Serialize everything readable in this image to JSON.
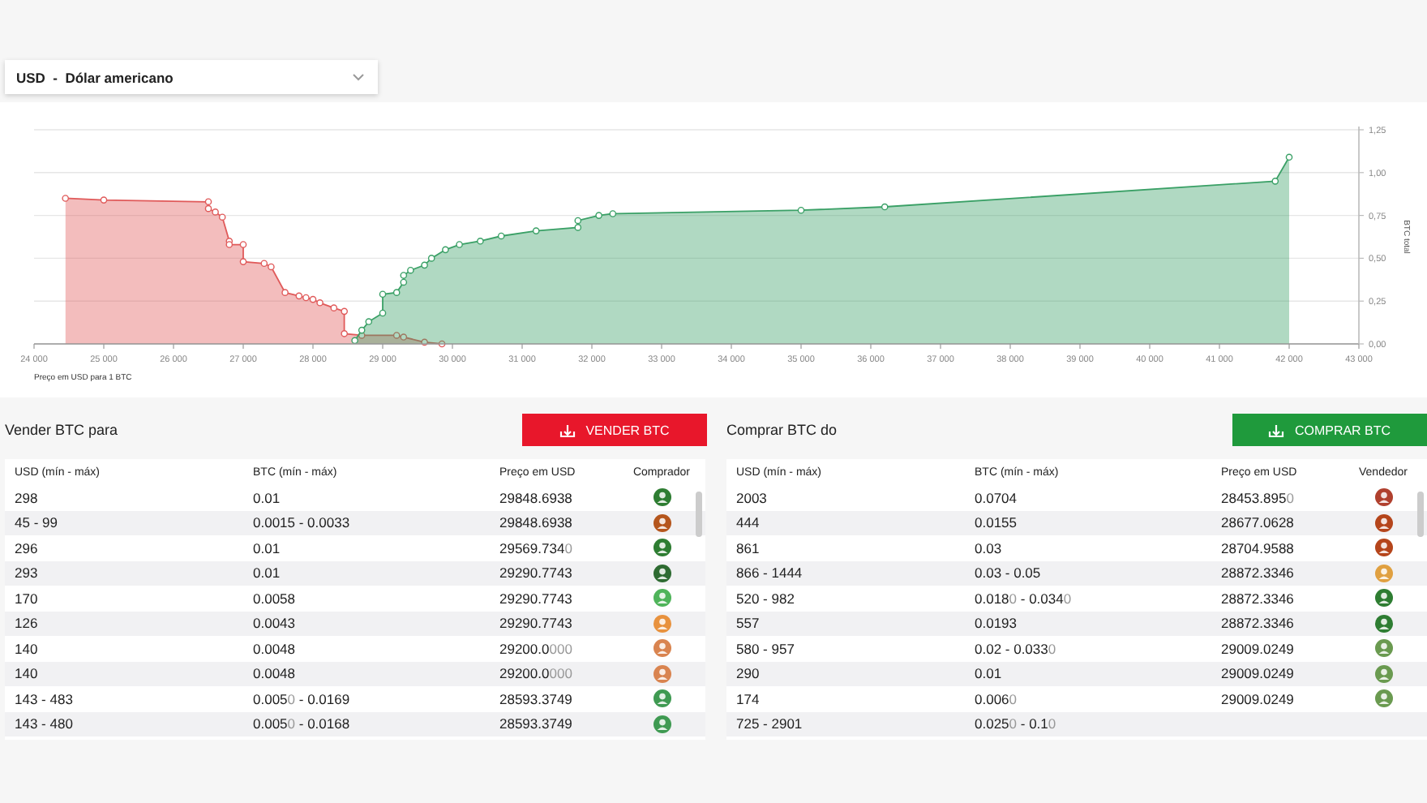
{
  "currency_select": {
    "value": "USD  -  Dólar americano"
  },
  "depth_chart": {
    "chart_data": {
      "type": "area",
      "xlabel": "Preço em USD para 1 BTC",
      "ylabel": "BTC total",
      "xlim": [
        24000,
        43000
      ],
      "ylim": [
        0,
        1.25
      ],
      "grid": true,
      "xticks": [
        {
          "value": 24000,
          "label": "24 000"
        },
        {
          "value": 25000,
          "label": "25 000"
        },
        {
          "value": 26000,
          "label": "26 000"
        },
        {
          "value": 27000,
          "label": "27 000"
        },
        {
          "value": 28000,
          "label": "28 000"
        },
        {
          "value": 29000,
          "label": "29 000"
        },
        {
          "value": 30000,
          "label": "30 000"
        },
        {
          "value": 31000,
          "label": "31 000"
        },
        {
          "value": 32000,
          "label": "32 000"
        },
        {
          "value": 33000,
          "label": "33 000"
        },
        {
          "value": 34000,
          "label": "34 000"
        },
        {
          "value": 35000,
          "label": "35 000"
        },
        {
          "value": 36000,
          "label": "36 000"
        },
        {
          "value": 37000,
          "label": "37 000"
        },
        {
          "value": 38000,
          "label": "38 000"
        },
        {
          "value": 39000,
          "label": "39 000"
        },
        {
          "value": 40000,
          "label": "40 000"
        },
        {
          "value": 41000,
          "label": "41 000"
        },
        {
          "value": 42000,
          "label": "42 000"
        },
        {
          "value": 43000,
          "label": "43 000"
        }
      ],
      "yticks": [
        {
          "value": 0,
          "label": "0,00"
        },
        {
          "value": 0.25,
          "label": "0,25"
        },
        {
          "value": 0.5,
          "label": "0,50"
        },
        {
          "value": 0.75,
          "label": "0,75"
        },
        {
          "value": 1,
          "label": "1,00"
        },
        {
          "value": 1.25,
          "label": "1,25"
        }
      ],
      "series": [
        {
          "color": "#e05a5a",
          "x": [
            24450,
            25000,
            26500,
            26500,
            26600,
            26700,
            26800,
            26800,
            27000,
            27000,
            27300,
            27400,
            27600,
            27800,
            27900,
            28000,
            28100,
            28300,
            28450,
            28450,
            28700,
            29200,
            29300,
            29600,
            29850
          ],
          "values": [
            0.85,
            0.84,
            0.83,
            0.79,
            0.77,
            0.74,
            0.6,
            0.58,
            0.58,
            0.48,
            0.47,
            0.45,
            0.3,
            0.28,
            0.27,
            0.26,
            0.24,
            0.21,
            0.19,
            0.06,
            0.05,
            0.05,
            0.04,
            0.01,
            0.0
          ]
        },
        {
          "color": "#3aa066",
          "x": [
            28600,
            28700,
            28800,
            29000,
            29000,
            29200,
            29300,
            29300,
            29400,
            29600,
            29700,
            29900,
            30100,
            30400,
            30700,
            31200,
            31800,
            31800,
            32100,
            32300,
            35000,
            36200,
            41800,
            42000
          ],
          "values": [
            0.02,
            0.08,
            0.13,
            0.18,
            0.29,
            0.3,
            0.36,
            0.4,
            0.43,
            0.46,
            0.5,
            0.55,
            0.58,
            0.6,
            0.63,
            0.66,
            0.68,
            0.72,
            0.75,
            0.76,
            0.78,
            0.8,
            0.95,
            1.09
          ]
        }
      ]
    }
  },
  "panels": [
    {
      "title": "Vender BTC para",
      "button": {
        "label": "VENDER BTC",
        "kind": "sell"
      },
      "columns": [
        "USD (mín - máx)",
        "BTC (mín - máx)",
        "Preço em USD",
        "Comprador"
      ],
      "rows": [
        {
          "cells": [
            "298",
            "0.01",
            "29848.6938"
          ],
          "color": "#2e7d32"
        },
        {
          "cells": [
            "45 - 99",
            "0.0015 - 0.0033",
            "29848.6938"
          ],
          "color": "#b5561d"
        },
        {
          "cells": [
            "296",
            "0.01",
            [
              "29569.734",
              "0"
            ]
          ],
          "color": "#2e7d32"
        },
        {
          "cells": [
            "293",
            "0.01",
            "29290.7743"
          ],
          "color": "#2e6b32"
        },
        {
          "cells": [
            "170",
            "0.0058",
            "29290.7743"
          ],
          "color": "#4fb45a"
        },
        {
          "cells": [
            "126",
            "0.0043",
            "29290.7743"
          ],
          "color": "#e8923e"
        },
        {
          "cells": [
            "140",
            "0.0048",
            [
              "29200.0",
              "000"
            ]
          ],
          "color": "#d98450"
        },
        {
          "cells": [
            "140",
            "0.0048",
            [
              "29200.0",
              "000"
            ]
          ],
          "color": "#d98450"
        },
        {
          "cells": [
            "143 - 483",
            [
              "0.005",
              "0",
              " - 0.0169"
            ],
            "28593.3749"
          ],
          "color": "#3f9a52"
        },
        {
          "cells": [
            "143 - 480",
            [
              "0.005",
              "0",
              " - 0.0168"
            ],
            "28593.3749"
          ],
          "color": "#3f9a52"
        }
      ]
    },
    {
      "title": "Comprar BTC do",
      "button": {
        "label": "COMPRAR BTC",
        "kind": "buy"
      },
      "columns": [
        "USD (mín - máx)",
        "BTC (mín - máx)",
        "Preço em USD",
        "Vendedor"
      ],
      "rows": [
        {
          "cells": [
            "2003",
            "0.0704",
            [
              "28453.895",
              "0"
            ]
          ],
          "color": "#b0402e"
        },
        {
          "cells": [
            "444",
            "0.0155",
            "28677.0628"
          ],
          "color": "#b5451b"
        },
        {
          "cells": [
            "861",
            "0.03",
            "28704.9588"
          ],
          "color": "#b5451b"
        },
        {
          "cells": [
            "866 - 1444",
            "0.03 - 0.05",
            "28872.3346"
          ],
          "color": "#e0a040"
        },
        {
          "cells": [
            "520 - 982",
            [
              "0.018",
              "0",
              " - 0.034",
              "0"
            ],
            "28872.3346"
          ],
          "color": "#2e7d32"
        },
        {
          "cells": [
            "557",
            "0.0193",
            "28872.3346"
          ],
          "color": "#2e7d32"
        },
        {
          "cells": [
            "580 - 957",
            [
              "0.02 - 0.033",
              "0"
            ],
            "29009.0249"
          ],
          "color": "#6a9a50"
        },
        {
          "cells": [
            "290",
            "0.01",
            "29009.0249"
          ],
          "color": "#6a9a50"
        },
        {
          "cells": [
            "174",
            [
              "0.006",
              "0"
            ],
            "29009.0249"
          ],
          "color": "#6a9a50"
        },
        {
          "cells": [
            "725 - 2901",
            [
              "0.025",
              "0",
              " - 0.1",
              "0"
            ]
          ]
        }
      ]
    }
  ]
}
